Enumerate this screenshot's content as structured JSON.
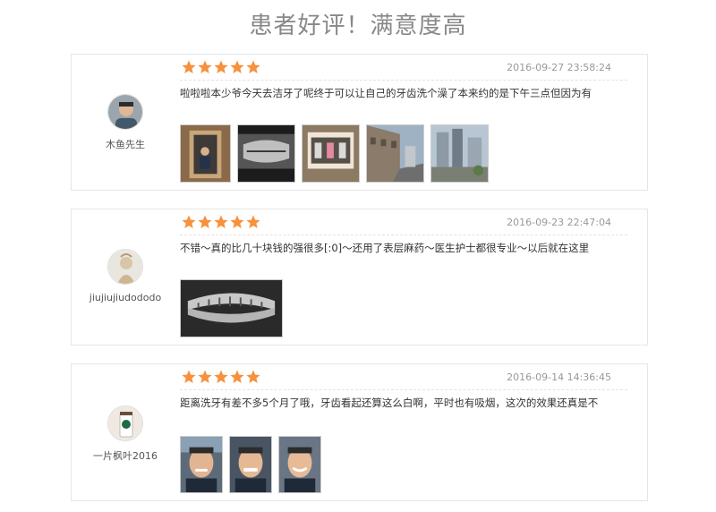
{
  "page_title": "患者好评！满意度高",
  "reviews": [
    {
      "user": "木鱼先生",
      "stars": 5,
      "date": "2016-09-27 23:58:24",
      "text": "啦啦啦本少爷今天去洁牙了呢终于可以让自己的牙齿洗个澡了本来约的是下午三点但因为有",
      "photos": [
        "photo-portrait-in-doorway",
        "photo-dental-xray-monitor",
        "photo-xray-lightbox",
        "photo-street-buildings",
        "photo-street-view"
      ]
    },
    {
      "user": "jiujiujiudododo",
      "stars": 5,
      "date": "2016-09-23 22:47:04",
      "text": "不错～真的比几十块钱的强很多[:0]～还用了表层麻药～医生护士都很专业～以后就在这里",
      "photos": [
        "photo-dental-xray"
      ]
    },
    {
      "user": "一片枫叶2016",
      "stars": 5,
      "date": "2016-09-14 14:36:45",
      "text": "距离洗牙有差不多5个月了哦，牙齿看起还算这么白啊，平时也有吸烟，这次的效果还真是不",
      "photos": [
        "photo-selfie-smile",
        "photo-selfie-teeth",
        "photo-selfie-grin"
      ]
    }
  ],
  "colors": {
    "star": "#f7913d",
    "title": "#888888",
    "border": "#e6e6e6",
    "date": "#999999"
  }
}
